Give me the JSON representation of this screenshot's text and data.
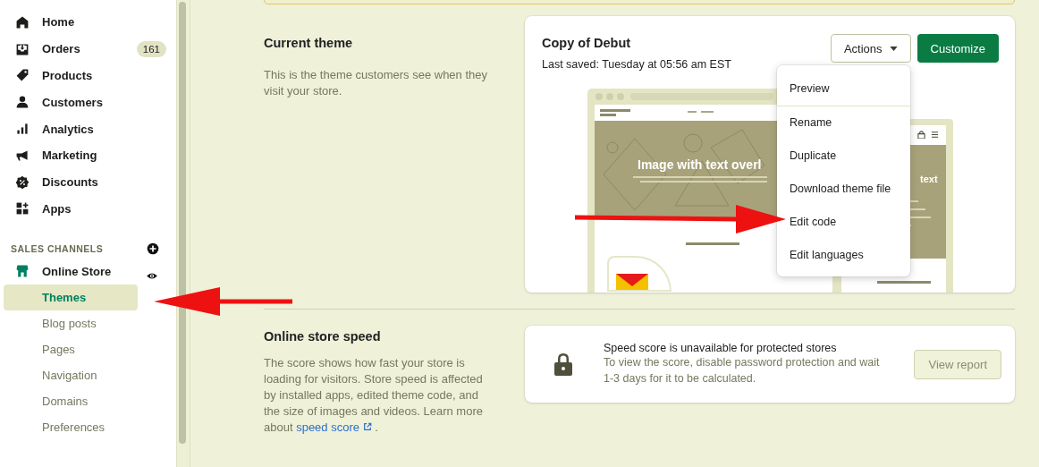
{
  "nav": {
    "items": [
      {
        "label": "Home",
        "kind": "home"
      },
      {
        "label": "Orders",
        "kind": "orders",
        "badge": "161"
      },
      {
        "label": "Products",
        "kind": "products"
      },
      {
        "label": "Customers",
        "kind": "customers"
      },
      {
        "label": "Analytics",
        "kind": "analytics"
      },
      {
        "label": "Marketing",
        "kind": "marketing"
      },
      {
        "label": "Discounts",
        "kind": "discounts"
      },
      {
        "label": "Apps",
        "kind": "apps"
      }
    ]
  },
  "sales_channels": {
    "heading": "SALES CHANNELS",
    "channel": {
      "label": "Online Store"
    },
    "subitems": [
      {
        "label": "Themes",
        "selected": true
      },
      {
        "label": "Blog posts",
        "selected": false
      },
      {
        "label": "Pages",
        "selected": false
      },
      {
        "label": "Navigation",
        "selected": false
      },
      {
        "label": "Domains",
        "selected": false
      },
      {
        "label": "Preferences",
        "selected": false
      }
    ]
  },
  "current_theme": {
    "title": "Current theme",
    "description": "This is the theme customers see when they visit your store.",
    "card": {
      "name": "Copy of Debut",
      "last_saved": "Last saved: Tuesday at 05:56 am EST",
      "actions_button": "Actions",
      "customize_button": "Customize",
      "menu": [
        {
          "label": "Preview"
        },
        {
          "label": "Rename"
        },
        {
          "label": "Duplicate"
        },
        {
          "label": "Download theme file"
        },
        {
          "label": "Edit code"
        },
        {
          "label": "Edit languages"
        }
      ],
      "preview": {
        "hero_title": "Image with text overl",
        "mobile_hero_title": "text"
      }
    }
  },
  "store_speed": {
    "title": "Online store speed",
    "description": "The score shows how fast your store is loading for visitors. Store speed is affected by installed apps, edited theme code, and the size of images and videos. Learn more about",
    "link": "speed score",
    "after_link": ".",
    "card": {
      "title": "Speed score is unavailable for protected stores",
      "text": "To view the score, disable password protection and wait 1-3 days for it to be calculated.",
      "button": "View report"
    }
  }
}
